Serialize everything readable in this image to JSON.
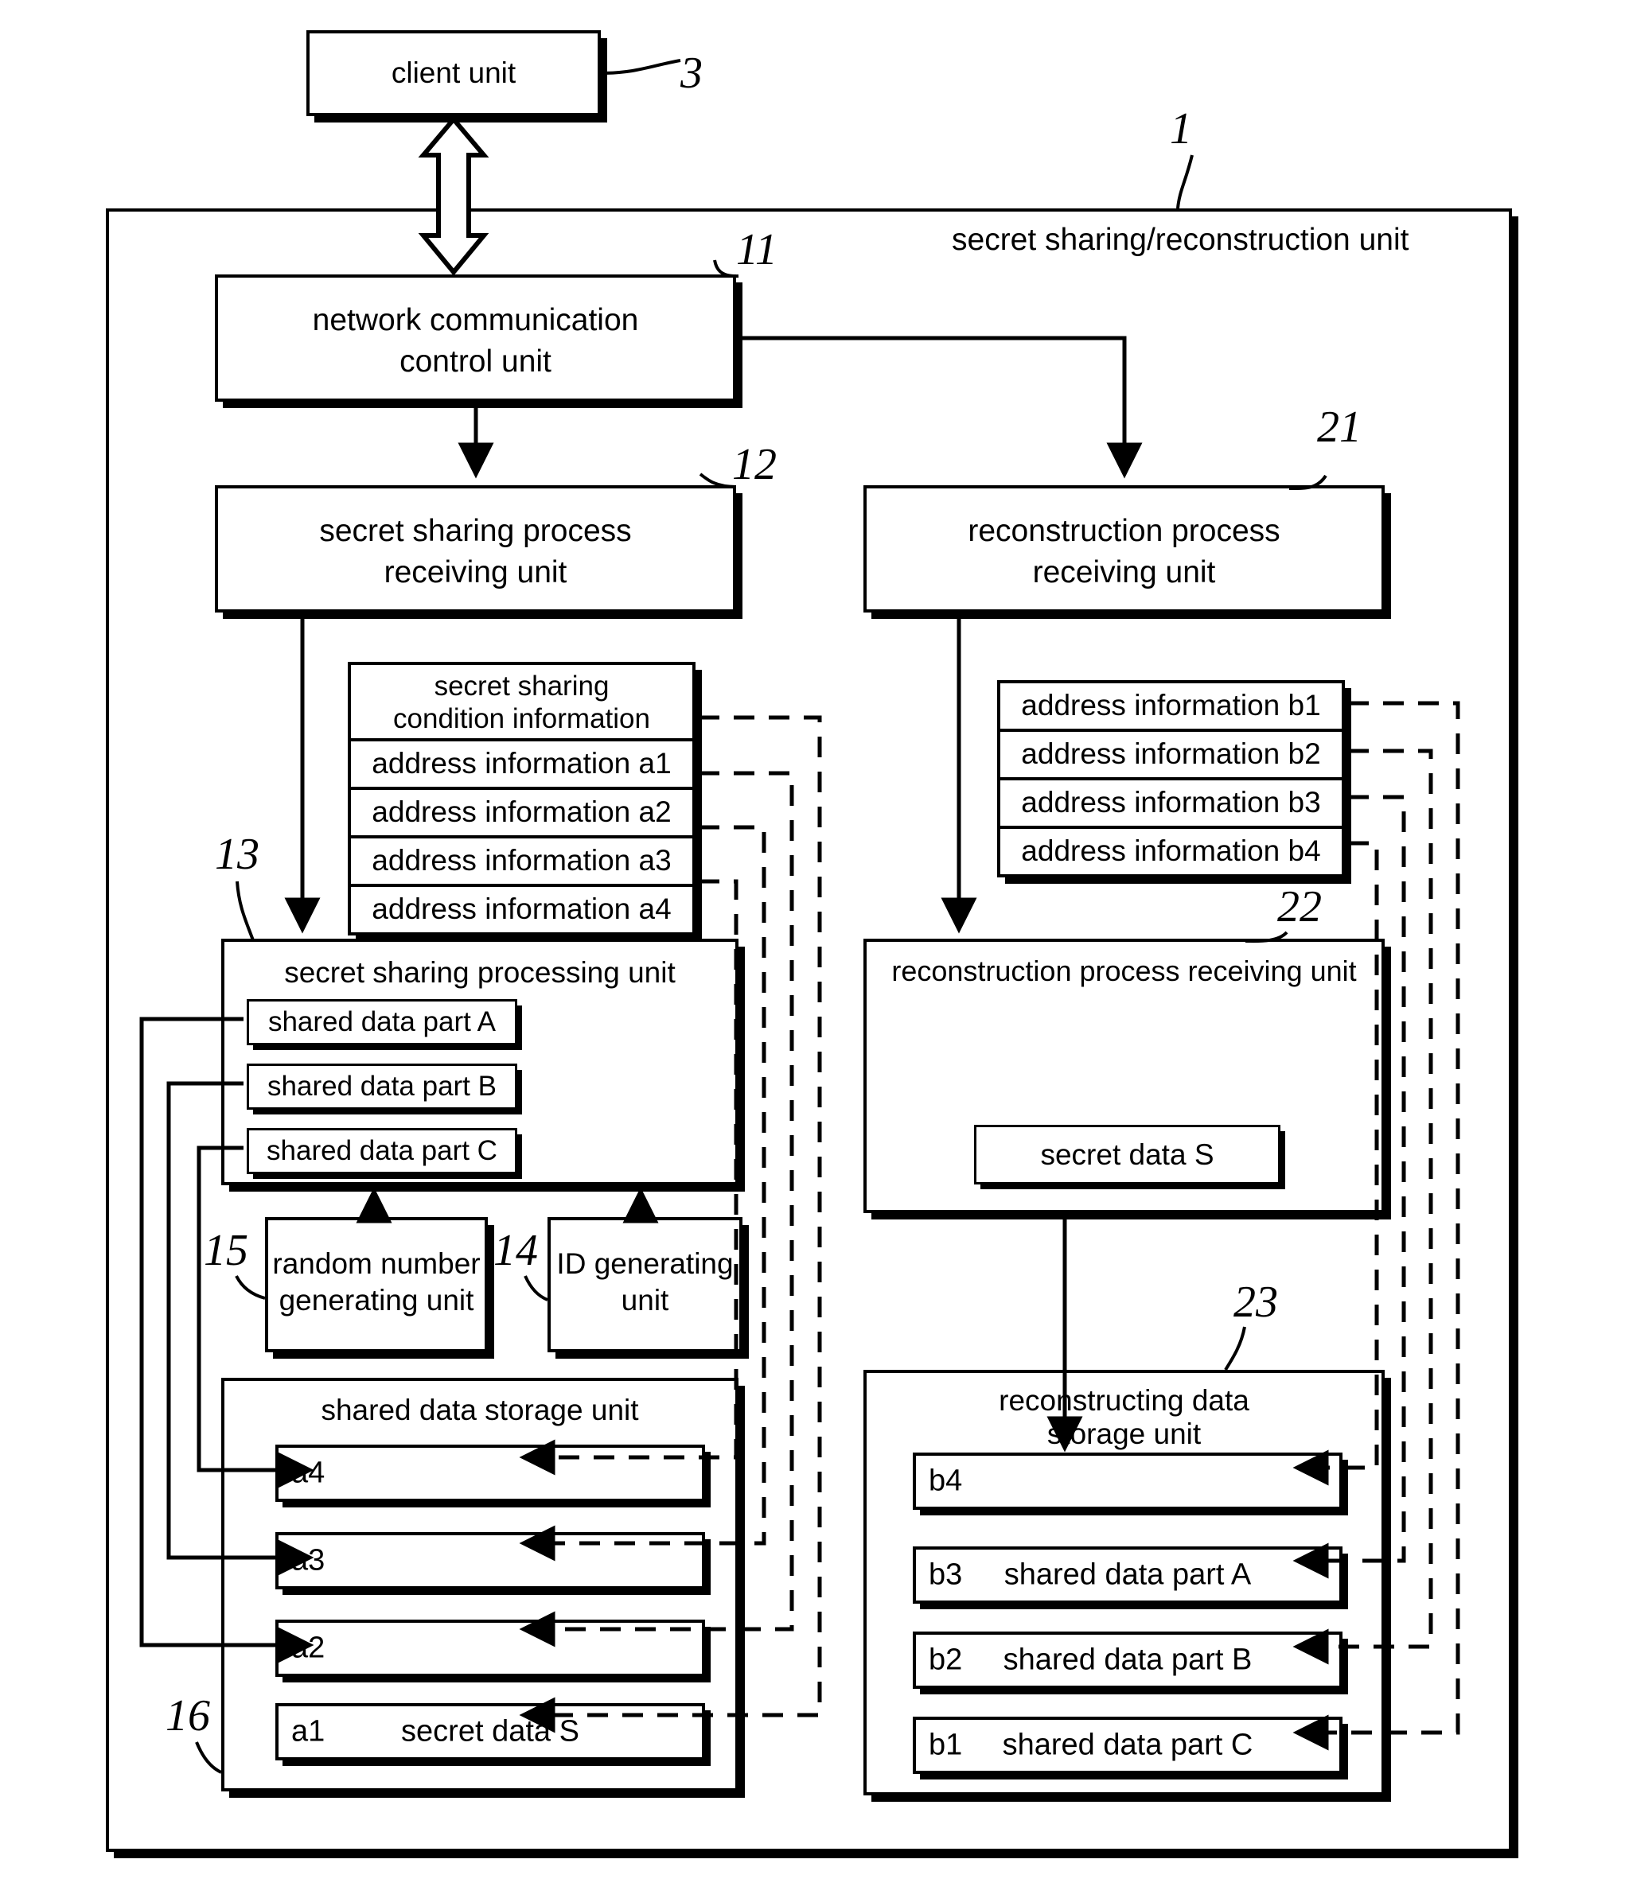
{
  "figure": {
    "outer_unit_label": "secret sharing/reconstruction unit",
    "ref_outer": "1",
    "ref_client": "3"
  },
  "client": {
    "label": "client unit"
  },
  "network": {
    "label": "network communication\ncontrol unit",
    "line1": "network communication",
    "line2": "control unit",
    "ref": "11"
  },
  "sharing_receiver": {
    "line1": "secret sharing process",
    "line2": "receiving unit",
    "ref": "12"
  },
  "reconstruction_receiver": {
    "line1": "reconstruction process",
    "line2": "receiving unit",
    "ref": "21"
  },
  "condition_info": {
    "header_line1": "secret sharing",
    "header_line2": "condition information",
    "rows": [
      "address information a1",
      "address information a2",
      "address information a3",
      "address information a4"
    ]
  },
  "address_info_b": {
    "rows": [
      "address information b1",
      "address information b2",
      "address information b3",
      "address information b4"
    ]
  },
  "sharing_processing": {
    "title": "secret sharing processing unit",
    "ref": "13",
    "parts": [
      "shared data part A",
      "shared data part B",
      "shared data part C"
    ]
  },
  "reconstruction_unit": {
    "title": "reconstruction process receiving unit",
    "ref": "22",
    "secret_box": "secret data S"
  },
  "random_unit": {
    "line1": "random number",
    "line2": "generating unit",
    "ref": "15"
  },
  "id_unit": {
    "line1": "ID generating",
    "line2": "unit",
    "ref": "14"
  },
  "shared_storage": {
    "title": "shared data storage unit",
    "ref": "16",
    "slots": [
      {
        "id": "a4",
        "value": ""
      },
      {
        "id": "a3",
        "value": ""
      },
      {
        "id": "a2",
        "value": ""
      },
      {
        "id": "a1",
        "value": "secret data S"
      }
    ]
  },
  "reconstruct_storage": {
    "title_line1": "reconstructing data",
    "title_line2": "storage unit",
    "ref": "23",
    "slots": [
      {
        "id": "b4",
        "value": ""
      },
      {
        "id": "b3",
        "value": "shared data part A"
      },
      {
        "id": "b2",
        "value": "shared data part B"
      },
      {
        "id": "b1",
        "value": "shared data part C"
      }
    ]
  }
}
